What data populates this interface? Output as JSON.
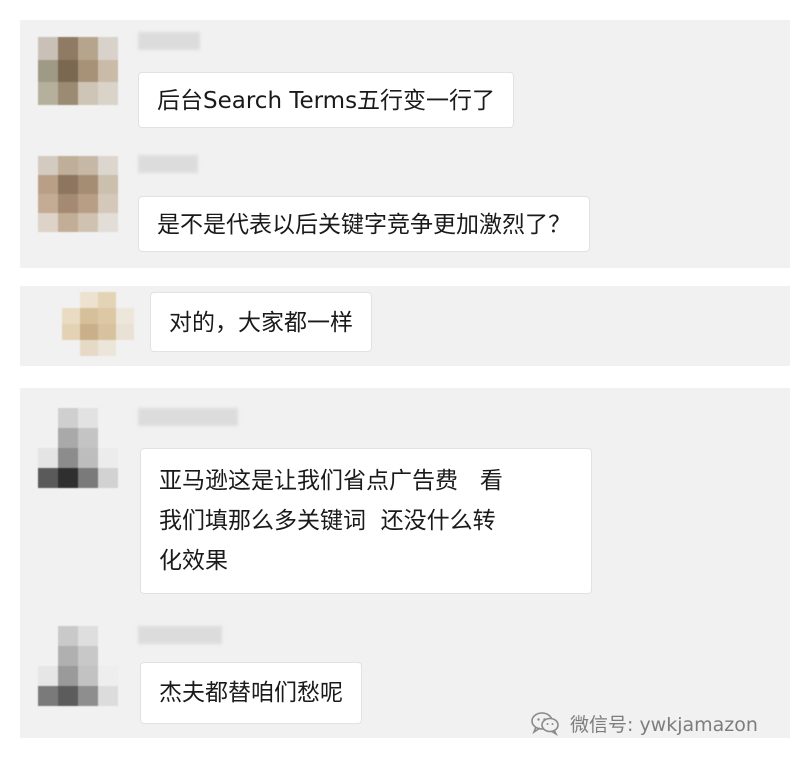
{
  "colors": {
    "panel_background": "#f1f1f1",
    "bubble_background": "#ffffff",
    "bubble_border": "#e2e2e2",
    "text": "#1a1a1a",
    "watermark_text": "#7d7d7d"
  },
  "messages": [
    {
      "text": "后台Search Terms五行变一行了"
    },
    {
      "text": "是不是代表以后关键字竞争更加激烈了？"
    },
    {
      "text": "对的，大家都一样"
    },
    {
      "lines": [
        "亚马逊这是让我们省点广告费   看",
        "我们填那么多关键词  还没什么转",
        "化效果"
      ]
    },
    {
      "text": "杰夫都替咱们愁呢"
    }
  ],
  "watermark": {
    "icon": "wechat-icon",
    "text": "微信号: ywkjamazon"
  }
}
